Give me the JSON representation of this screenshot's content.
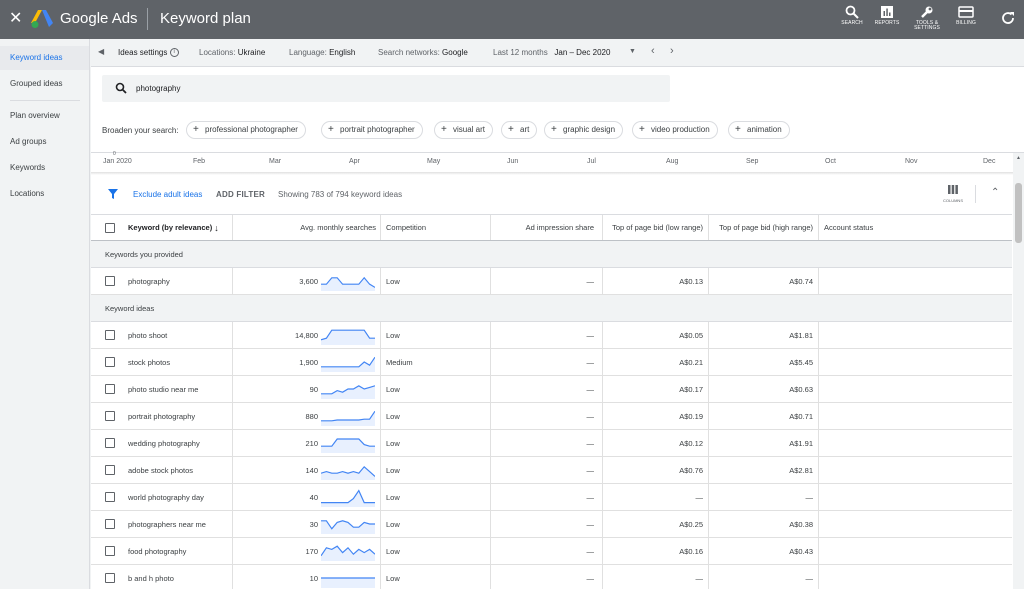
{
  "app": {
    "brand": "Google Ads",
    "title": "Keyword plan"
  },
  "tools": [
    {
      "label": "SEARCH",
      "icon": "search-icon"
    },
    {
      "label": "REPORTS",
      "icon": "reports-icon"
    },
    {
      "label": "TOOLS & SETTINGS",
      "icon": "wrench-icon"
    },
    {
      "label": "BILLING",
      "icon": "billing-icon"
    }
  ],
  "sidebar": {
    "items": [
      {
        "label": "Keyword ideas",
        "active": true
      },
      {
        "label": "Grouped ideas"
      },
      {
        "label": "Plan overview"
      },
      {
        "label": "Ad groups"
      },
      {
        "label": "Keywords"
      },
      {
        "label": "Locations"
      }
    ]
  },
  "settings": {
    "ideas_settings": "Ideas settings",
    "locations_label": "Locations:",
    "locations_value": "Ukraine",
    "language_label": "Language:",
    "language_value": "English",
    "networks_label": "Search networks:",
    "networks_value": "Google",
    "period_label": "Last 12 months",
    "period_value": "Jan – Dec 2020"
  },
  "search": {
    "value": "photography"
  },
  "broaden": {
    "label": "Broaden your search:",
    "chips": [
      "professional photographer",
      "portrait photographer",
      "visual art",
      "art",
      "graphic design",
      "video production",
      "animation"
    ]
  },
  "timeline": {
    "zero": "0",
    "months": [
      "Jan 2020",
      "Feb",
      "Mar",
      "Apr",
      "May",
      "Jun",
      "Jul",
      "Aug",
      "Sep",
      "Oct",
      "Nov",
      "Dec"
    ]
  },
  "filters": {
    "exclude_adult": "Exclude adult ideas",
    "add_filter": "ADD FILTER",
    "showing": "Showing 783 of 794 keyword ideas",
    "columns": "COLUMNS"
  },
  "table": {
    "headers": {
      "keyword": "Keyword (by relevance)",
      "searches": "Avg. monthly searches",
      "competition": "Competition",
      "impression": "Ad impression share",
      "bid_low": "Top of page bid (low range)",
      "bid_high": "Top of page bid (high range)",
      "status": "Account status"
    },
    "provided_group": "Keywords you provided",
    "ideas_group": "Keyword ideas",
    "provided": [
      {
        "keyword": "photography",
        "searches": "3,600",
        "competition": "Low",
        "impression": "—",
        "bid_low": "A$0.13",
        "bid_high": "A$0.74",
        "trend": [
          0.3,
          0.3,
          0.7,
          0.7,
          0.3,
          0.3,
          0.3,
          0.3,
          0.7,
          0.3,
          0.1
        ]
      }
    ],
    "ideas": [
      {
        "keyword": "photo shoot",
        "searches": "14,800",
        "competition": "Low",
        "impression": "—",
        "bid_low": "A$0.05",
        "bid_high": "A$1.81",
        "trend": [
          0.2,
          0.3,
          0.8,
          0.8,
          0.8,
          0.8,
          0.8,
          0.8,
          0.8,
          0.3,
          0.3
        ]
      },
      {
        "keyword": "stock photos",
        "searches": "1,900",
        "competition": "Medium",
        "impression": "—",
        "bid_low": "A$0.21",
        "bid_high": "A$5.45",
        "trend": [
          0.2,
          0.2,
          0.2,
          0.2,
          0.2,
          0.2,
          0.2,
          0.2,
          0.5,
          0.3,
          0.8
        ]
      },
      {
        "keyword": "photo studio near me",
        "searches": "90",
        "competition": "Low",
        "impression": "—",
        "bid_low": "A$0.17",
        "bid_high": "A$0.63",
        "trend": [
          0.2,
          0.2,
          0.2,
          0.4,
          0.3,
          0.5,
          0.5,
          0.7,
          0.5,
          0.6,
          0.7
        ]
      },
      {
        "keyword": "portrait photography",
        "searches": "880",
        "competition": "Low",
        "impression": "—",
        "bid_low": "A$0.19",
        "bid_high": "A$0.71",
        "trend": [
          0.2,
          0.2,
          0.2,
          0.25,
          0.25,
          0.25,
          0.25,
          0.25,
          0.3,
          0.3,
          0.8
        ]
      },
      {
        "keyword": "wedding photography",
        "searches": "210",
        "competition": "Low",
        "impression": "—",
        "bid_low": "A$0.12",
        "bid_high": "A$1.91",
        "trend": [
          0.3,
          0.3,
          0.3,
          0.75,
          0.75,
          0.75,
          0.75,
          0.75,
          0.4,
          0.3,
          0.3
        ]
      },
      {
        "keyword": "adobe stock photos",
        "searches": "140",
        "competition": "Low",
        "impression": "—",
        "bid_low": "A$0.76",
        "bid_high": "A$2.81",
        "trend": [
          0.3,
          0.4,
          0.3,
          0.3,
          0.4,
          0.3,
          0.4,
          0.3,
          0.7,
          0.4,
          0.1
        ]
      },
      {
        "keyword": "world photography day",
        "searches": "40",
        "competition": "Low",
        "impression": "—",
        "bid_low": "—",
        "bid_high": "—",
        "trend": [
          0.15,
          0.15,
          0.15,
          0.15,
          0.15,
          0.15,
          0.4,
          0.9,
          0.15,
          0.15,
          0.15
        ]
      },
      {
        "keyword": "photographers near me",
        "searches": "30",
        "competition": "Low",
        "impression": "—",
        "bid_low": "A$0.25",
        "bid_high": "A$0.38",
        "trend": [
          0.7,
          0.7,
          0.2,
          0.6,
          0.7,
          0.6,
          0.3,
          0.3,
          0.6,
          0.5,
          0.5
        ]
      },
      {
        "keyword": "food photography",
        "searches": "170",
        "competition": "Low",
        "impression": "—",
        "bid_low": "A$0.16",
        "bid_high": "A$0.43",
        "trend": [
          0.2,
          0.7,
          0.6,
          0.8,
          0.4,
          0.7,
          0.3,
          0.6,
          0.4,
          0.6,
          0.3
        ]
      },
      {
        "keyword": "b and h photo",
        "searches": "10",
        "competition": "Low",
        "impression": "—",
        "bid_low": "—",
        "bid_high": "—",
        "trend": [
          0.5,
          0.5,
          0.5,
          0.5,
          0.5,
          0.5,
          0.5,
          0.5,
          0.5,
          0.5,
          0.5
        ]
      }
    ]
  },
  "colors": {
    "topbar": "#5f6368",
    "accent": "#1a73e8",
    "trend_line": "#4285f4",
    "trend_fill": "#e8f0fe"
  }
}
